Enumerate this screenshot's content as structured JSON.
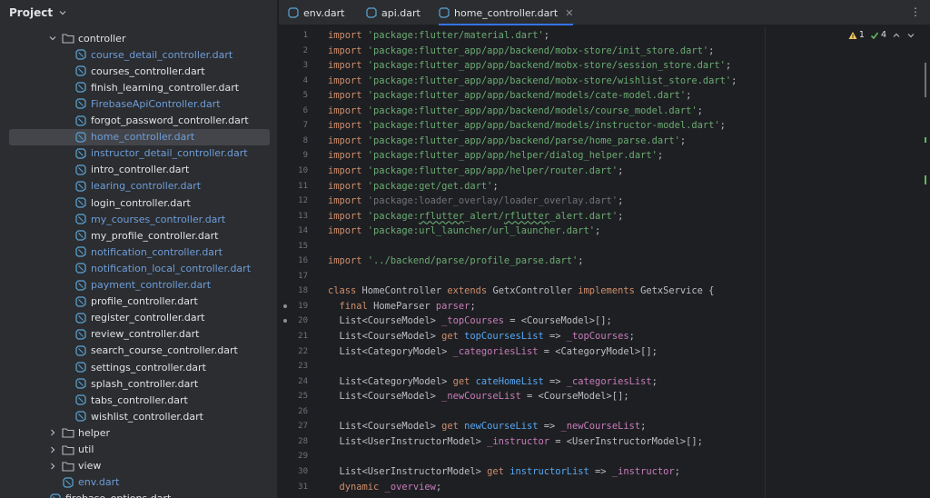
{
  "project": {
    "title": "Project",
    "tree": [
      {
        "label": "controller",
        "type": "folder",
        "expanded": true,
        "color": "white"
      },
      {
        "label": "course_detail_controller.dart",
        "type": "file",
        "color": "blue"
      },
      {
        "label": "courses_controller.dart",
        "type": "file",
        "color": "white"
      },
      {
        "label": "finish_learning_controller.dart",
        "type": "file",
        "color": "white"
      },
      {
        "label": "FirebaseApiController.dart",
        "type": "file",
        "color": "blue"
      },
      {
        "label": "forgot_password_controller.dart",
        "type": "file",
        "color": "white"
      },
      {
        "label": "home_controller.dart",
        "type": "file",
        "color": "blue",
        "selected": true
      },
      {
        "label": "instructor_detail_controller.dart",
        "type": "file",
        "color": "blue"
      },
      {
        "label": "intro_controller.dart",
        "type": "file",
        "color": "white"
      },
      {
        "label": "learing_controller.dart",
        "type": "file",
        "color": "blue"
      },
      {
        "label": "login_controller.dart",
        "type": "file",
        "color": "white"
      },
      {
        "label": "my_courses_controller.dart",
        "type": "file",
        "color": "blue"
      },
      {
        "label": "my_profile_controller.dart",
        "type": "file",
        "color": "white"
      },
      {
        "label": "notification_controller.dart",
        "type": "file",
        "color": "blue"
      },
      {
        "label": "notification_local_controller.dart",
        "type": "file",
        "color": "blue"
      },
      {
        "label": "payment_controller.dart",
        "type": "file",
        "color": "blue"
      },
      {
        "label": "profile_controller.dart",
        "type": "file",
        "color": "white"
      },
      {
        "label": "register_controller.dart",
        "type": "file",
        "color": "white"
      },
      {
        "label": "review_controller.dart",
        "type": "file",
        "color": "white"
      },
      {
        "label": "search_course_controller.dart",
        "type": "file",
        "color": "white"
      },
      {
        "label": "settings_controller.dart",
        "type": "file",
        "color": "white"
      },
      {
        "label": "splash_controller.dart",
        "type": "file",
        "color": "white"
      },
      {
        "label": "tabs_controller.dart",
        "type": "file",
        "color": "white"
      },
      {
        "label": "wishlist_controller.dart",
        "type": "file",
        "color": "white"
      },
      {
        "label": "helper",
        "type": "folder",
        "expanded": false,
        "color": "white"
      },
      {
        "label": "util",
        "type": "folder",
        "expanded": false,
        "color": "white"
      },
      {
        "label": "view",
        "type": "folder",
        "expanded": false,
        "color": "white"
      },
      {
        "label": "env.dart",
        "type": "file",
        "color": "blue"
      },
      {
        "label": "firebase_options.dart",
        "type": "file",
        "color": "white"
      }
    ]
  },
  "tabs": [
    {
      "label": "env.dart",
      "active": false
    },
    {
      "label": "api.dart",
      "active": false
    },
    {
      "label": "home_controller.dart",
      "active": true
    }
  ],
  "inspections": {
    "warnings": "1",
    "checks": "4"
  },
  "code_lines": [
    [
      [
        "kw",
        "import "
      ],
      [
        "str",
        "'package:flutter/material.dart'"
      ],
      [
        "plain",
        ";"
      ]
    ],
    [
      [
        "kw",
        "import "
      ],
      [
        "str",
        "'package:flutter_app/app/backend/mobx-store/init_store.dart'"
      ],
      [
        "plain",
        ";"
      ]
    ],
    [
      [
        "kw",
        "import "
      ],
      [
        "str",
        "'package:flutter_app/app/backend/mobx-store/session_store.dart'"
      ],
      [
        "plain",
        ";"
      ]
    ],
    [
      [
        "kw",
        "import "
      ],
      [
        "str",
        "'package:flutter_app/app/backend/mobx-store/wishlist_store.dart'"
      ],
      [
        "plain",
        ";"
      ]
    ],
    [
      [
        "kw",
        "import "
      ],
      [
        "str",
        "'package:flutter_app/app/backend/models/cate-model.dart'"
      ],
      [
        "plain",
        ";"
      ]
    ],
    [
      [
        "kw",
        "import "
      ],
      [
        "str",
        "'package:flutter_app/app/backend/models/course_model.dart'"
      ],
      [
        "plain",
        ";"
      ]
    ],
    [
      [
        "kw",
        "import "
      ],
      [
        "str",
        "'package:flutter_app/app/backend/models/instructor-model.dart'"
      ],
      [
        "plain",
        ";"
      ]
    ],
    [
      [
        "kw",
        "import "
      ],
      [
        "str",
        "'package:flutter_app/app/backend/parse/home_parse.dart'"
      ],
      [
        "plain",
        ";"
      ]
    ],
    [
      [
        "kw",
        "import "
      ],
      [
        "str",
        "'package:flutter_app/app/helper/dialog_helper.dart'"
      ],
      [
        "plain",
        ";"
      ]
    ],
    [
      [
        "kw",
        "import "
      ],
      [
        "str",
        "'package:flutter_app/app/helper/router.dart'"
      ],
      [
        "plain",
        ";"
      ]
    ],
    [
      [
        "kw",
        "import "
      ],
      [
        "str",
        "'package:get/get.dart'"
      ],
      [
        "plain",
        ";"
      ]
    ],
    [
      [
        "kw",
        "import "
      ],
      [
        "str-dim",
        "'package:loader_overlay/loader_overlay.dart'"
      ],
      [
        "plain",
        ";"
      ]
    ],
    [
      [
        "kw",
        "import "
      ],
      [
        "str",
        "'package:"
      ],
      [
        "str wavy",
        "rflutter"
      ],
      [
        "str",
        "_alert/"
      ],
      [
        "str wavy",
        "rflutter"
      ],
      [
        "str",
        "_alert.dart'"
      ],
      [
        "plain",
        ";"
      ]
    ],
    [
      [
        "kw",
        "import "
      ],
      [
        "str",
        "'package:url_launcher/url_launcher.dart'"
      ],
      [
        "plain",
        ";"
      ]
    ],
    [],
    [
      [
        "kw",
        "import "
      ],
      [
        "str",
        "'../backend/parse/profile_parse.dart'"
      ],
      [
        "plain",
        ";"
      ]
    ],
    [],
    [
      [
        "kw",
        "class "
      ],
      [
        "plain",
        "HomeController "
      ],
      [
        "kw",
        "extends "
      ],
      [
        "plain",
        "GetxController "
      ],
      [
        "kw",
        "implements "
      ],
      [
        "plain",
        "GetxService {"
      ]
    ],
    [
      [
        "plain",
        "  "
      ],
      [
        "kw",
        "final "
      ],
      [
        "plain",
        "HomeParser "
      ],
      [
        "fld",
        "parser"
      ],
      [
        "plain",
        ";"
      ]
    ],
    [
      [
        "plain",
        "  List<CourseModel> "
      ],
      [
        "fld",
        "_topCourses"
      ],
      [
        "plain",
        " = <CourseModel>[];"
      ]
    ],
    [
      [
        "plain",
        "  List<CourseModel> "
      ],
      [
        "kw",
        "get "
      ],
      [
        "fn",
        "topCoursesList"
      ],
      [
        "plain",
        " => "
      ],
      [
        "fld",
        "_topCourses"
      ],
      [
        "plain",
        ";"
      ]
    ],
    [
      [
        "plain",
        "  List<CategoryModel> "
      ],
      [
        "fld",
        "_categoriesList"
      ],
      [
        "plain",
        " = <CategoryModel>[];"
      ]
    ],
    [],
    [
      [
        "plain",
        "  List<CategoryModel> "
      ],
      [
        "kw",
        "get "
      ],
      [
        "fn",
        "cateHomeList"
      ],
      [
        "plain",
        " => "
      ],
      [
        "fld",
        "_categoriesList"
      ],
      [
        "plain",
        ";"
      ]
    ],
    [
      [
        "plain",
        "  List<CourseModel> "
      ],
      [
        "fld",
        "_newCourseList"
      ],
      [
        "plain",
        " = <CourseModel>[];"
      ]
    ],
    [],
    [
      [
        "plain",
        "  List<CourseModel> "
      ],
      [
        "kw",
        "get "
      ],
      [
        "fn",
        "newCourseList"
      ],
      [
        "plain",
        " => "
      ],
      [
        "fld",
        "_newCourseList"
      ],
      [
        "plain",
        ";"
      ]
    ],
    [
      [
        "plain",
        "  List<UserInstructorModel> "
      ],
      [
        "fld",
        "_instructor"
      ],
      [
        "plain",
        " = <UserInstructorModel>[];"
      ]
    ],
    [],
    [
      [
        "plain",
        "  List<UserInstructorModel> "
      ],
      [
        "kw",
        "get "
      ],
      [
        "fn",
        "instructorList"
      ],
      [
        "plain",
        " => "
      ],
      [
        "fld",
        "_instructor"
      ],
      [
        "plain",
        ";"
      ]
    ],
    [
      [
        "plain",
        "  "
      ],
      [
        "kw",
        "dynamic "
      ],
      [
        "fld",
        "_overview"
      ],
      [
        "plain",
        ";"
      ]
    ]
  ],
  "colors": {
    "background": "#1e1f22",
    "panel": "#2b2d30",
    "selection": "#43454a",
    "accent": "#3574f0",
    "keyword": "#cf8e6d",
    "string": "#6aab73",
    "field": "#c77dbb",
    "function": "#56a8f5",
    "modified_file": "#6f9dd8"
  },
  "icons": {
    "folder": "folder-icon",
    "dart_file": "dart-file-icon",
    "warning": "warning-icon",
    "check": "check-icon"
  }
}
